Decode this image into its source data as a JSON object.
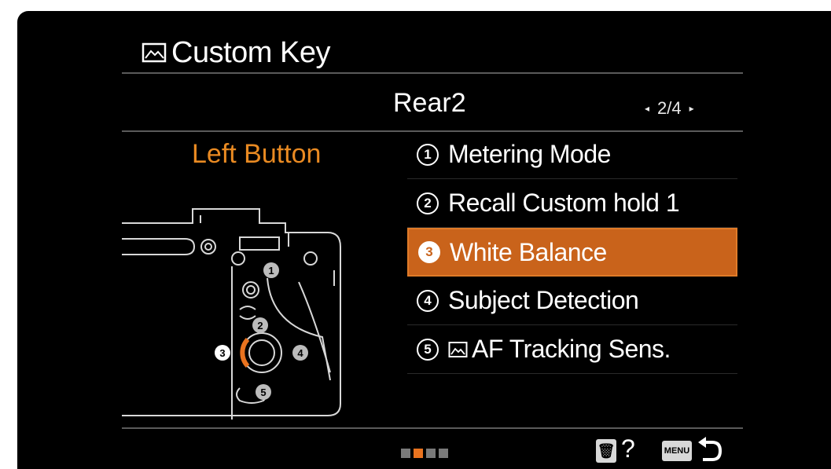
{
  "header": {
    "title": "Custom Key",
    "title_icon": "still-image-icon"
  },
  "page": {
    "name": "Rear2",
    "indicator": "2/4"
  },
  "left_panel": {
    "label": "Left Button",
    "diagram_numbers": [
      "1",
      "2",
      "3",
      "4",
      "5"
    ]
  },
  "menu": {
    "items": [
      {
        "number": "1",
        "label": "Metering Mode",
        "selected": false
      },
      {
        "number": "2",
        "label": "Recall Custom hold 1",
        "selected": false
      },
      {
        "number": "3",
        "label": "White Balance",
        "selected": true
      },
      {
        "number": "4",
        "label": "Subject Detection",
        "selected": false
      },
      {
        "number": "5",
        "label": "AF Tracking Sens.",
        "selected": false,
        "icon": "still-image-icon"
      }
    ]
  },
  "footer": {
    "page_dots": 4,
    "active_dot": 2,
    "delete_icon": "trash-icon",
    "help_label": "?",
    "menu_button_label": "MENU",
    "back_icon": "return-arrow-icon"
  },
  "colors": {
    "accent": "#e98a22",
    "selected_bg": "#c9631b",
    "background": "#000000"
  }
}
